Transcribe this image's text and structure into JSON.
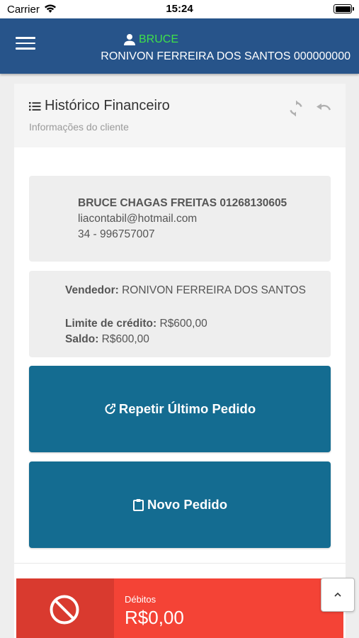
{
  "status_bar": {
    "carrier": "Carrier",
    "time": "15:24"
  },
  "app_bar": {
    "user_name": "BRUCE",
    "seller_line": "RONIVON FERREIRA DOS SANTOS 000000000"
  },
  "header": {
    "title": "Histórico Financeiro",
    "subtitle": "Informações do cliente"
  },
  "client": {
    "name_line": "BRUCE CHAGAS FREITAS 01268130605",
    "email": "liacontabil@hotmail.com",
    "phone": "34 - 996757007"
  },
  "vendor": {
    "seller_label": "Vendedor:",
    "seller_value": " RONIVON FERREIRA DOS SANTOS",
    "credit_label": "Limite de crédito:",
    "credit_value": " R$600,00",
    "balance_label": "Saldo:",
    "balance_value": " R$600,00"
  },
  "actions": {
    "repeat_label": "Repetir Último Pedido",
    "new_label": "Novo Pedido"
  },
  "debits": {
    "label": "Débitos",
    "value": "R$0,00"
  },
  "colors": {
    "app_bar": "#27548a",
    "user_name": "#3fe04a",
    "action_button": "#146c91",
    "debit": "#f44336",
    "debit_dark": "#d93a2f"
  },
  "icons": {
    "menu": "hamburger-icon",
    "user": "person-icon",
    "list": "list-icon",
    "refresh": "refresh-icon",
    "undo": "undo-icon",
    "repeat": "repeat-icon",
    "clipboard": "clipboard-icon",
    "ban": "ban-icon",
    "scroll_top": "chevron-up-icon"
  }
}
